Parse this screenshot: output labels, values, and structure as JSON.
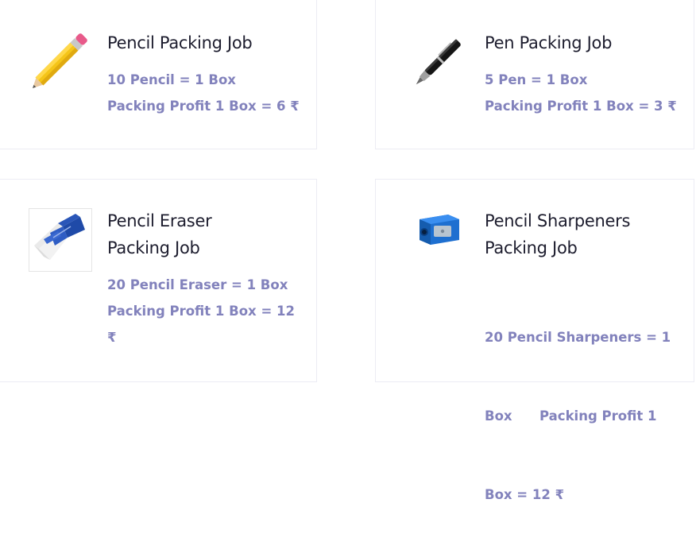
{
  "cards": [
    {
      "title": "Pencil Packing Job",
      "line1": "10 Pencil = 1 Box",
      "line2": "Packing Profit 1 Box = 6 ₹",
      "icon": "pencil-icon"
    },
    {
      "title": "Pen Packing Job",
      "line1": "5 Pen = 1 Box",
      "line2": "Packing Profit 1 Box = 3 ₹",
      "icon": "fountain-pen-icon"
    },
    {
      "title_line1": "Pencil Eraser",
      "title_line2": "Packing Job",
      "line1": "20 Pencil Eraser = 1 Box",
      "line2": "Packing Profit 1 Box = 12",
      "line3": "₹",
      "icon": "eraser-icon"
    },
    {
      "title_line1": "Pencil Sharpeners",
      "title_line2": "Packing Job",
      "line1": "20 Pencil Sharpeners = 1",
      "line2": "Box      Packing Profit 1",
      "line3": "Box = 12 ₹",
      "icon": "sharpener-icon"
    }
  ],
  "colors": {
    "title": "#1d1d2e",
    "description": "#8282bc",
    "card_border": "#ececf4"
  }
}
